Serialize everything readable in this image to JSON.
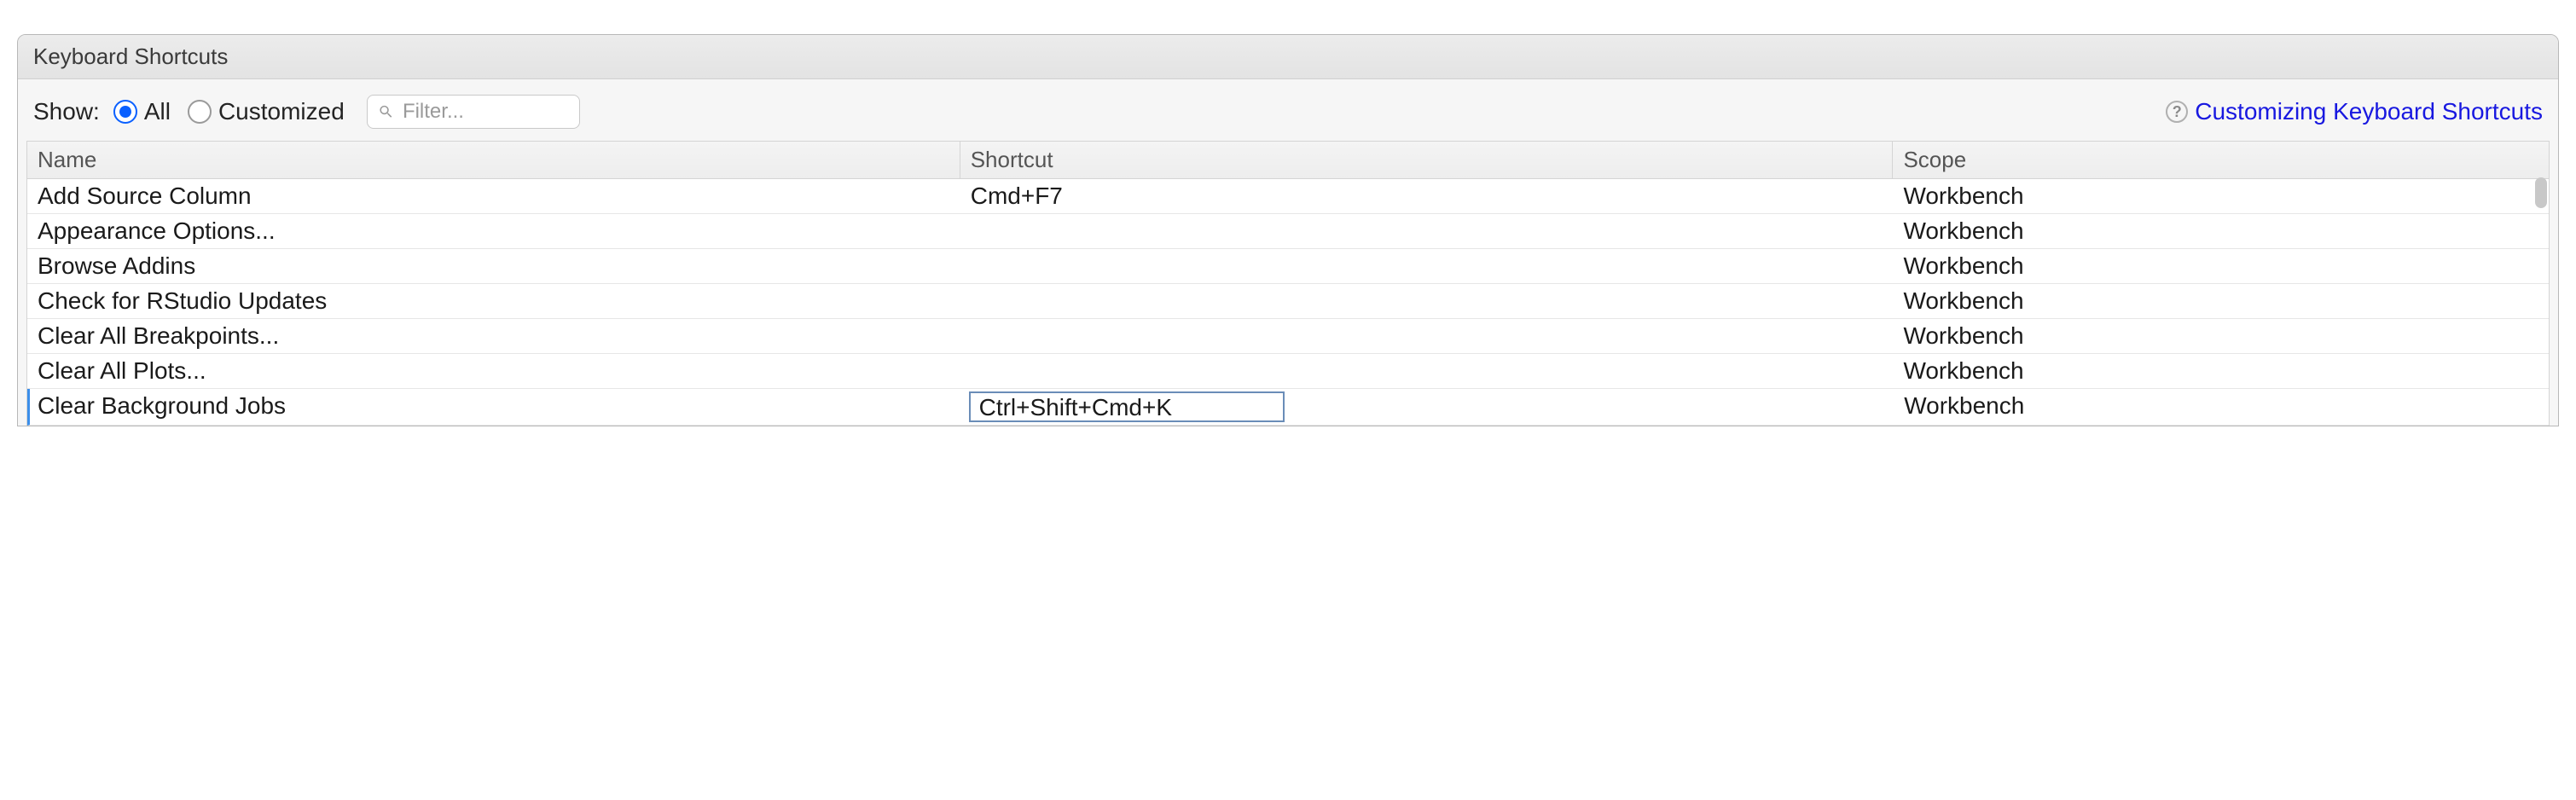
{
  "dialog": {
    "title": "Keyboard Shortcuts"
  },
  "toolbar": {
    "show_label": "Show:",
    "radio_all": "All",
    "radio_customized": "Customized",
    "filter_placeholder": "Filter...",
    "help_link": "Customizing Keyboard Shortcuts",
    "help_symbol": "?"
  },
  "table": {
    "headers": {
      "name": "Name",
      "shortcut": "Shortcut",
      "scope": "Scope"
    },
    "rows": [
      {
        "name": "Add Source Column",
        "shortcut": "Cmd+F7",
        "scope": "Workbench",
        "editing": false
      },
      {
        "name": "Appearance Options...",
        "shortcut": "",
        "scope": "Workbench",
        "editing": false
      },
      {
        "name": "Browse Addins",
        "shortcut": "",
        "scope": "Workbench",
        "editing": false
      },
      {
        "name": "Check for RStudio Updates",
        "shortcut": "",
        "scope": "Workbench",
        "editing": false
      },
      {
        "name": "Clear All Breakpoints...",
        "shortcut": "",
        "scope": "Workbench",
        "editing": false
      },
      {
        "name": "Clear All Plots...",
        "shortcut": "",
        "scope": "Workbench",
        "editing": false
      },
      {
        "name": "Clear Background Jobs",
        "shortcut": "Ctrl+Shift+Cmd+K",
        "scope": "Workbench",
        "editing": true
      }
    ]
  }
}
